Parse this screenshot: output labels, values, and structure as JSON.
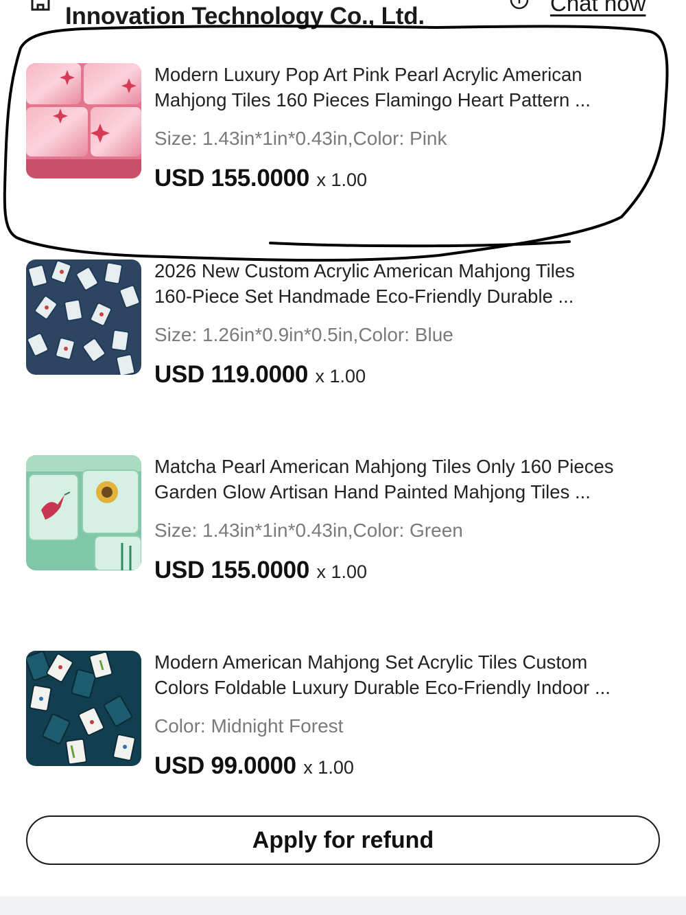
{
  "header": {
    "store_icon": "store-icon",
    "store_name": "Innovation Technology Co., Ltd.",
    "chat_icon": "chat-bubble-icon",
    "chat_label": "Chat now"
  },
  "items": [
    {
      "title_line1": "Modern Luxury Pop Art Pink Pearl Acrylic American",
      "title_line2": "Mahjong Tiles 160 Pieces Flamingo Heart Pattern ...",
      "variant": "Size: 1.43in*1in*0.43in,Color: Pink",
      "price": "USD 155.0000",
      "quantity": "x 1.00",
      "image": "pink-mahjong-tiles-photo"
    },
    {
      "title_line1": "2026 New Custom Acrylic American Mahjong Tiles",
      "title_line2": "160-Piece Set Handmade Eco-Friendly Durable ...",
      "variant": "Size: 1.26in*0.9in*0.5in,Color: Blue",
      "price": "USD 119.0000",
      "quantity": "x 1.00",
      "image": "blue-mahjong-tiles-photo"
    },
    {
      "title_line1": "Matcha Pearl American Mahjong Tiles Only 160 Pieces",
      "title_line2": "Garden Glow Artisan Hand Painted Mahjong Tiles ...",
      "variant": "Size: 1.43in*1in*0.43in,Color: Green",
      "price": "USD 155.0000",
      "quantity": "x 1.00",
      "image": "green-mahjong-tiles-photo"
    },
    {
      "title_line1": "Modern American Mahjong Set Acrylic Tiles Custom",
      "title_line2": "Colors Foldable Luxury Durable Eco-Friendly Indoor ...",
      "variant": "Color: Midnight Forest",
      "price": "USD 99.0000",
      "quantity": "x 1.00",
      "image": "midnight-forest-mahjong-tiles-photo"
    }
  ],
  "actions": {
    "refund_label": "Apply for refund"
  },
  "colors": {
    "text": "#1c1c1c",
    "muted": "#7a7a7a",
    "annotation": "#000000",
    "bottom_bar": "#f1f2f4"
  }
}
